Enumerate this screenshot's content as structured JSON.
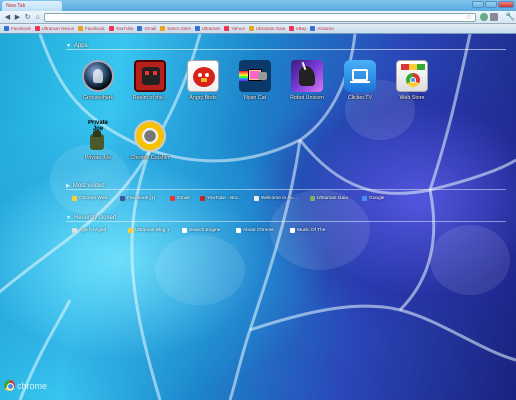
{
  "window": {
    "tab_title": "New Tab"
  },
  "toolbar": {
    "back_icon": "back-arrow-icon",
    "forward_icon": "forward-arrow-icon",
    "reload_icon": "reload-icon",
    "home_icon": "home-icon",
    "omnibox_value": ""
  },
  "bookmarks": [
    {
      "label": "Facebook"
    },
    {
      "label": "Ultraman Nexus"
    },
    {
      "label": "Facebook"
    },
    {
      "label": "YouTube"
    },
    {
      "label": "Gmail"
    },
    {
      "label": "Sam's Sites"
    },
    {
      "label": "Ultraman"
    },
    {
      "label": "Yahoo!"
    },
    {
      "label": "Ultraman Gaia"
    },
    {
      "label": "eBay"
    },
    {
      "label": "Amazon"
    }
  ],
  "apps_section": {
    "title": "Apps"
  },
  "apps": [
    {
      "label": "Grooveshark",
      "icon": "grooveshark-icon"
    },
    {
      "label": "Realm of the...",
      "icon": "realm-of-the-mad-god-icon"
    },
    {
      "label": "Angry Birds",
      "icon": "angry-birds-icon"
    },
    {
      "label": "Nyan Cat",
      "icon": "nyan-cat-icon"
    },
    {
      "label": "Robot Unicorn",
      "icon": "robot-unicorn-icon"
    },
    {
      "label": "Clicker.TV",
      "icon": "clicker-tv-icon"
    },
    {
      "label": "Web Store",
      "icon": "web-store-icon"
    },
    {
      "label": "Private Joe",
      "icon": "private-joe-icon"
    },
    {
      "label": "Chrome Crusher",
      "icon": "chrome-crusher-icon"
    }
  ],
  "most_visited_section": {
    "title": "Most visited"
  },
  "most_visited": [
    {
      "label": "Chrome Web..."
    },
    {
      "label": "Facebook (1)"
    },
    {
      "label": "Gmail"
    },
    {
      "label": "YouTube - Bro..."
    },
    {
      "label": "Welcome to Ac..."
    },
    {
      "label": "Ultraman Gaia"
    },
    {
      "label": "Google"
    }
  ],
  "recently_closed_section": {
    "title": "Recently closed"
  },
  "recently_closed": [
    {
      "label": "Age Of Aged"
    },
    {
      "label": "Ultraman Blog 1"
    },
    {
      "label": "Search Engine"
    },
    {
      "label": "About Chrome"
    },
    {
      "label": "Music Of The"
    }
  ],
  "branding": {
    "wordmark": "chrome"
  }
}
